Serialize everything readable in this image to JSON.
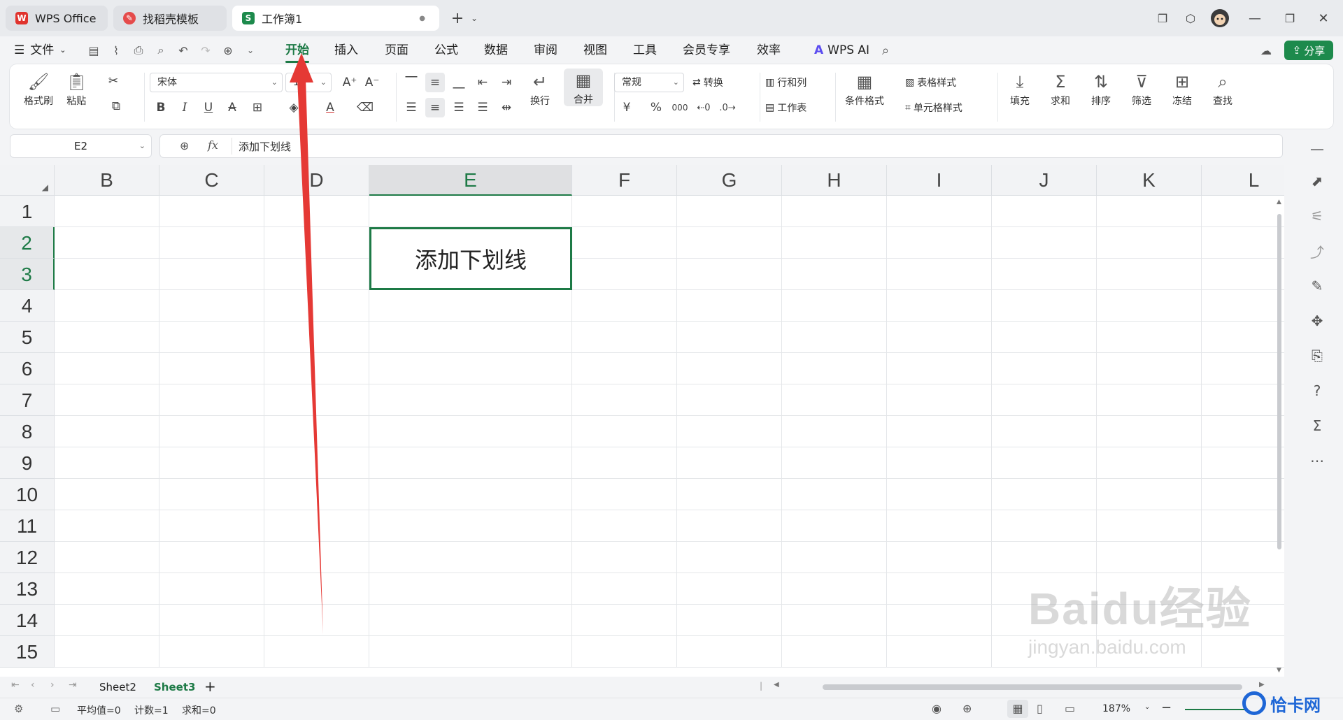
{
  "tabs": [
    {
      "label": "WPS Office",
      "icon": "wps-logo-icon"
    },
    {
      "label": "找稻壳模板",
      "icon": "docer-logo-icon"
    },
    {
      "label": "工作簿1",
      "icon": "sheet-logo-icon"
    }
  ],
  "menu": {
    "file": "文件",
    "items": [
      "开始",
      "插入",
      "页面",
      "公式",
      "数据",
      "审阅",
      "视图",
      "工具",
      "会员专享",
      "效率"
    ],
    "active": "开始",
    "ai": "WPS AI",
    "share": "分享"
  },
  "ribbon": {
    "format_painter": "格式刷",
    "paste": "粘贴",
    "font_name": "宋体",
    "font_size": "11",
    "wrap": "换行",
    "merge": "合并",
    "number_format": "常规",
    "convert": "转换",
    "rows_cols": "行和列",
    "worksheet": "工作表",
    "cond_format": "条件格式",
    "table_style": "表格样式",
    "cell_style": "单元格样式",
    "fill": "填充",
    "sum": "求和",
    "sort": "排序",
    "filter": "筛选",
    "freeze": "冻结",
    "find": "查找",
    "bold": "B",
    "italic": "I",
    "underline": "U",
    "strike": "A",
    "currency": "¥",
    "percent": "%",
    "thousands": "000"
  },
  "formula_bar": {
    "cell_ref": "E2",
    "fx": "fx",
    "content": "添加下划线"
  },
  "grid": {
    "columns": [
      "B",
      "C",
      "D",
      "E",
      "F",
      "G",
      "H",
      "I",
      "J",
      "K",
      "L"
    ],
    "selected_column": "E",
    "rows": [
      "1",
      "2",
      "3",
      "4",
      "5",
      "6",
      "7",
      "8",
      "9",
      "10",
      "11",
      "12",
      "13",
      "14",
      "15"
    ],
    "selected_rows": [
      "2",
      "3"
    ],
    "merged_cell_text": "添加下划线"
  },
  "sheets": [
    "Sheet2",
    "Sheet3"
  ],
  "active_sheet": "Sheet3",
  "status": {
    "average": "平均值=0",
    "count": "计数=1",
    "sum": "求和=0",
    "zoom": "187%"
  },
  "watermark": {
    "brand": "Baidu经验",
    "url": "jingyan.baidu.com",
    "corner": "恰卡网"
  },
  "colors": {
    "accent": "#1d7a46",
    "arrow": "#e53935"
  }
}
